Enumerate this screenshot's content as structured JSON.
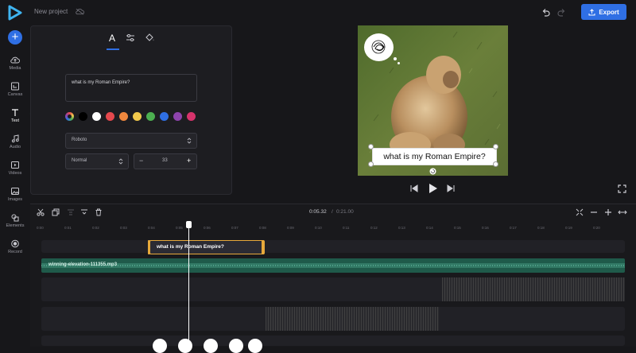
{
  "topbar": {
    "project_name": "New project",
    "export_label": "Export",
    "accent": "#2f6fe4"
  },
  "rail": {
    "items": [
      {
        "label": "Media",
        "icon": "cloud-upload-icon"
      },
      {
        "label": "Canvas",
        "icon": "canvas-icon"
      },
      {
        "label": "Text",
        "icon": "text-icon"
      },
      {
        "label": "Audio",
        "icon": "music-note-icon"
      },
      {
        "label": "Videos",
        "icon": "video-icon"
      },
      {
        "label": "Images",
        "icon": "image-icon"
      },
      {
        "label": "Elements",
        "icon": "shapes-icon"
      },
      {
        "label": "Record",
        "icon": "record-icon"
      }
    ]
  },
  "panel": {
    "tabs": [
      {
        "icon": "text-a-icon",
        "label": "A",
        "active": true
      },
      {
        "icon": "sliders-icon"
      },
      {
        "icon": "paint-bucket-icon"
      }
    ],
    "text_value": "what is my Roman Empire?",
    "swatches": [
      "#000000",
      "#ffffff",
      "#e5484d",
      "#f0883e",
      "#f2c94c",
      "#4caf50",
      "#2f6fe4",
      "#8e44ad",
      "#d6336c"
    ],
    "font_family": "Roboto",
    "font_weight": "Normal",
    "font_size": "33",
    "minus_label": "−",
    "plus_label": "+"
  },
  "preview": {
    "caption": "what is my Roman Empire?"
  },
  "timeline": {
    "current_time": "0:05.32",
    "separator": "/",
    "total_time": "0:21.00",
    "ticks": [
      "0:00",
      "0:01",
      "0:02",
      "0:03",
      "0:04",
      "0:05",
      "0:06",
      "0:07",
      "0:08",
      "0:09",
      "0:10",
      "0:11",
      "0:12",
      "0:13",
      "0:14",
      "0:15",
      "0:16",
      "0:17",
      "0:18",
      "0:19",
      "0:20"
    ],
    "text_clip_label": "what is my Roman Empire?",
    "audio_clip_label": "winning-elevation-111355.mp3"
  }
}
